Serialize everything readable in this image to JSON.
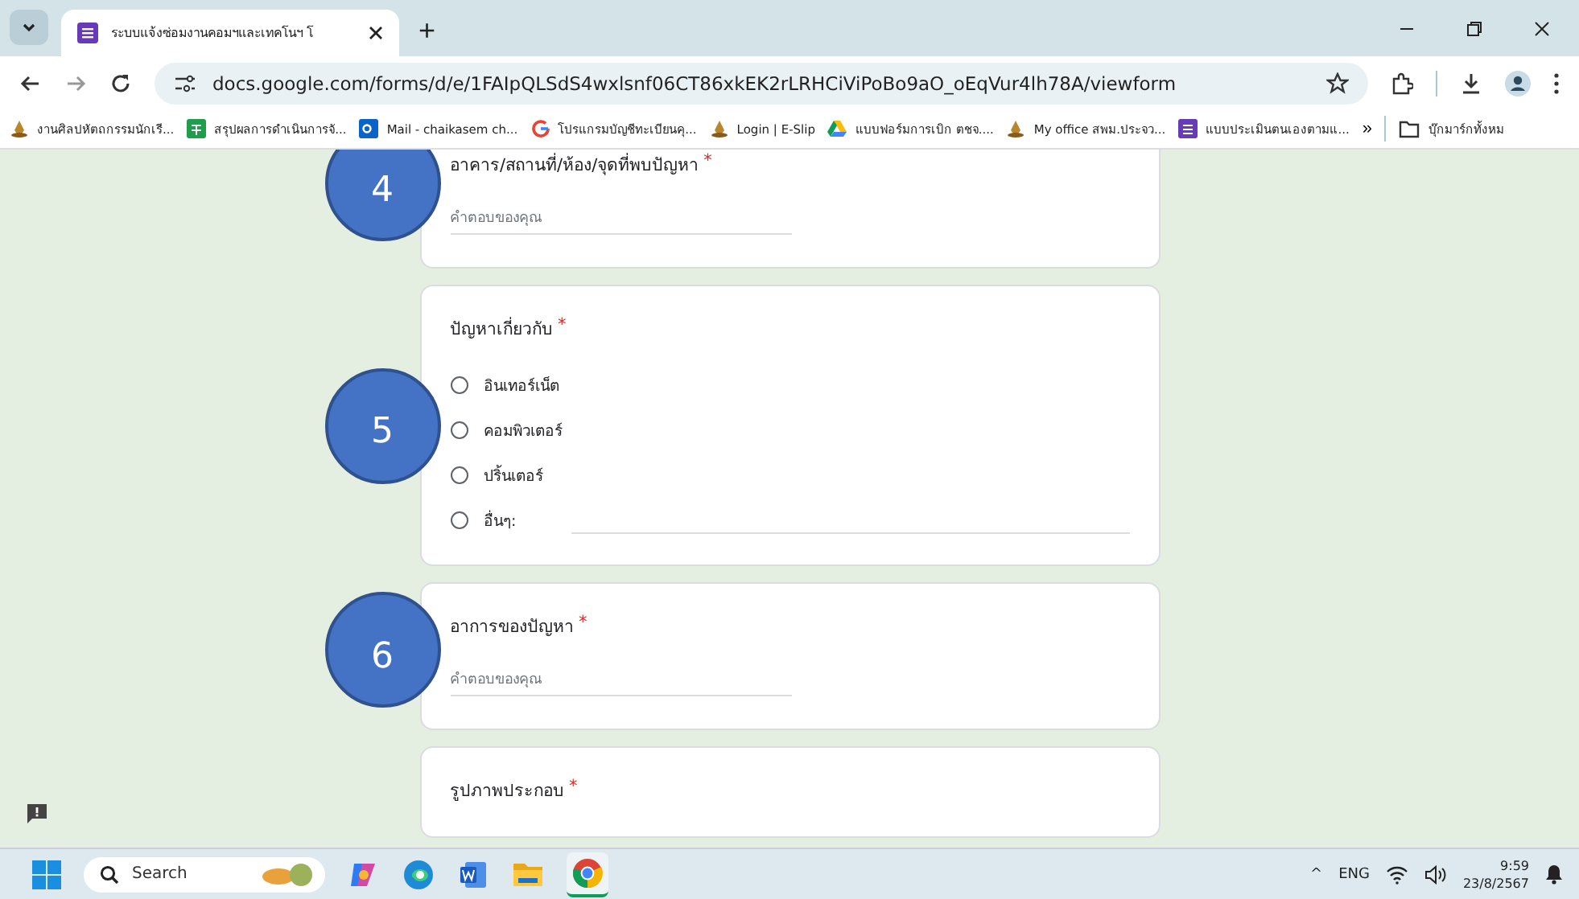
{
  "browser": {
    "tabs": [
      {
        "title": "ระบบแจ้งซ่อมงานคอมฯและเทคโนฯ โ",
        "selected": true
      }
    ],
    "new_tab": "+",
    "url": "docs.google.com/forms/d/e/1FAIpQLSdS4wxlsnf06CT86xkEK2rLRHCiViPoBo9aO_oEqVur4lh78A/viewform"
  },
  "bookmarks": [
    {
      "label": "งานศิลปหัตถกรรมนักเรี...",
      "kind": "emblem"
    },
    {
      "label": "สรุปผลการดำเนินการจั...",
      "kind": "sheets"
    },
    {
      "label": "Mail - chaikasem ch...",
      "kind": "outlook"
    },
    {
      "label": "โปรแกรมบัญชีทะเบียนคุ...",
      "kind": "google"
    },
    {
      "label": "Login | E-Slip",
      "kind": "emblem"
    },
    {
      "label": "แบบฟอร์มการเบิก ตชจ....",
      "kind": "drive"
    },
    {
      "label": "My office สพม.ประจว...",
      "kind": "emblem"
    },
    {
      "label": "แบบประเมินตนเองตามแ...",
      "kind": "forms"
    }
  ],
  "bookmarks_more": "»",
  "all_bookmarks": "บุ๊กมาร์กทั้งหม",
  "questions": [
    {
      "number": "4",
      "title": "อาคาร/สถานที่/ห้อง/จุดที่พบปัญหา",
      "required_mark": "*",
      "kind": "text",
      "placeholder": "คำตอบของคุณ"
    },
    {
      "number": "5",
      "title": "ปัญหาเกี่ยวกับ",
      "required_mark": "*",
      "kind": "radio",
      "options": [
        {
          "label": "อินเทอร์เน็ต",
          "selected": false,
          "kind": "choice"
        },
        {
          "label": "คอมพิวเตอร์",
          "selected": false,
          "kind": "choice"
        },
        {
          "label": "ปริ้นเตอร์",
          "selected": false,
          "kind": "choice"
        },
        {
          "label": "อื่นๆ:",
          "selected": false,
          "kind": "other"
        }
      ]
    },
    {
      "number": "6",
      "title": "อาการของปัญหา",
      "required_mark": "*",
      "kind": "text",
      "placeholder": "คำตอบของคุณ"
    },
    {
      "title": "รูปภาพประกอบ",
      "required_mark": "*",
      "kind": "upload"
    }
  ],
  "taskbar": {
    "search": "Search",
    "tray": {
      "chevron": "^",
      "language": "ENG",
      "time": "9:59",
      "date": "23/8/2567"
    }
  }
}
